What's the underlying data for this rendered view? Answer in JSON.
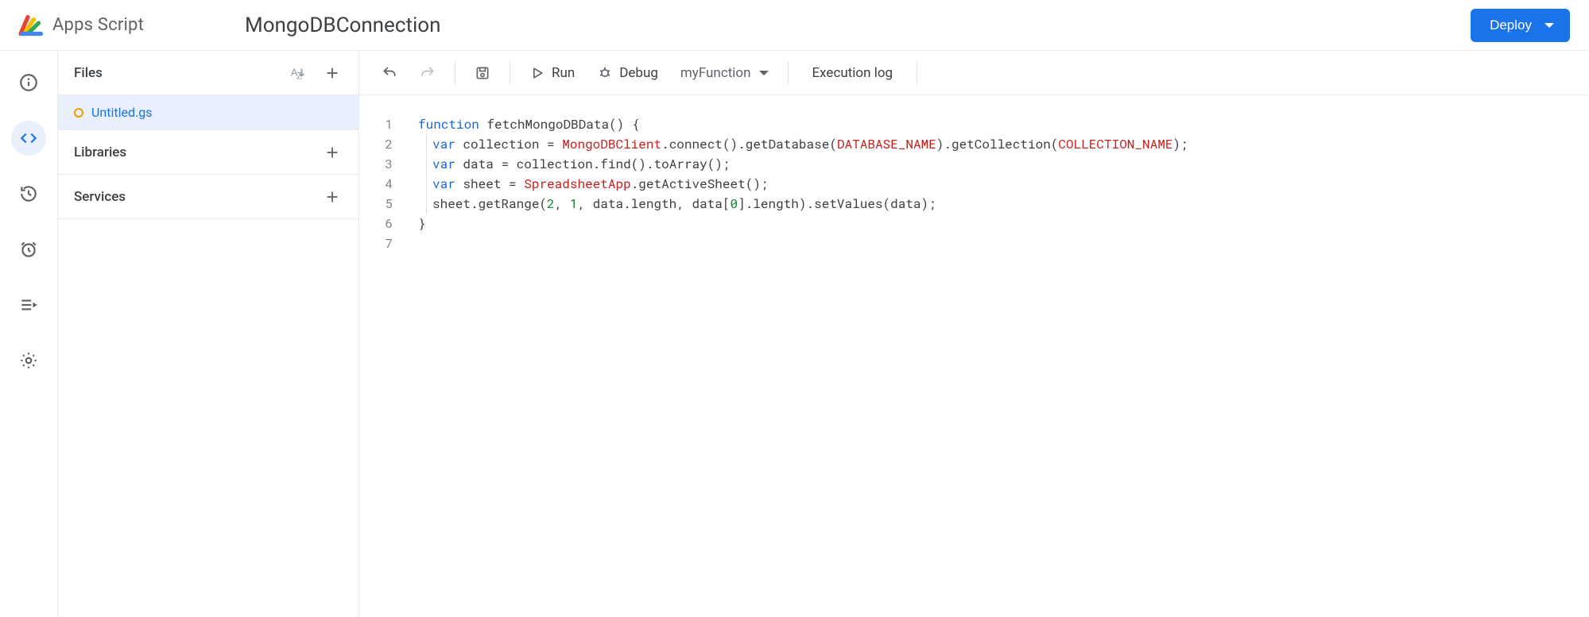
{
  "header": {
    "logo_text": "Apps Script",
    "project_name": "MongoDBConnection",
    "deploy_label": "Deploy"
  },
  "rail": {
    "items": [
      {
        "name": "info-icon"
      },
      {
        "name": "editor-icon",
        "active": true
      },
      {
        "name": "history-icon"
      },
      {
        "name": "triggers-icon"
      },
      {
        "name": "executions-icon"
      },
      {
        "name": "settings-icon"
      }
    ]
  },
  "files_panel": {
    "files_label": "Files",
    "libraries_label": "Libraries",
    "services_label": "Services",
    "files": [
      {
        "name": "Untitled.gs",
        "unsaved": true
      }
    ]
  },
  "toolbar": {
    "run_label": "Run",
    "debug_label": "Debug",
    "function_selected": "myFunction",
    "execution_log_label": "Execution log"
  },
  "code": {
    "line_numbers": [
      "1",
      "2",
      "3",
      "4",
      "5",
      "6",
      "7"
    ],
    "tokens_line1": {
      "kw": "function",
      "id": "fetchMongoDBData",
      "p1": "()",
      " p2": "{"
    },
    "tokens_line2": {
      "kw": "var",
      "id1": "collection",
      "eq": "=",
      "t1": "MongoDBClient",
      "m1": ".connect().getDatabase(",
      "c1": "DATABASE_NAME",
      "m2": ").getCollection(",
      "c2": "COLLECTION_NAME",
      "m3": ");"
    },
    "tokens_line3": {
      "kw": "var",
      "id": "data",
      "eq": "=",
      "rest": "collection.find().toArray();"
    },
    "tokens_line4": {
      "kw": "var",
      "id": "sheet",
      "eq": "=",
      "t1": "SpreadsheetApp",
      "rest": ".getActiveSheet();"
    },
    "tokens_line5": {
      "pre": "sheet.getRange(",
      "n1": "2",
      "c1": ", ",
      "n2": "1",
      "c2": ", data.length, data[",
      "n3": "0",
      "post": "].length).setValues(data);"
    },
    "tokens_line6": {
      "brace": "}"
    }
  }
}
